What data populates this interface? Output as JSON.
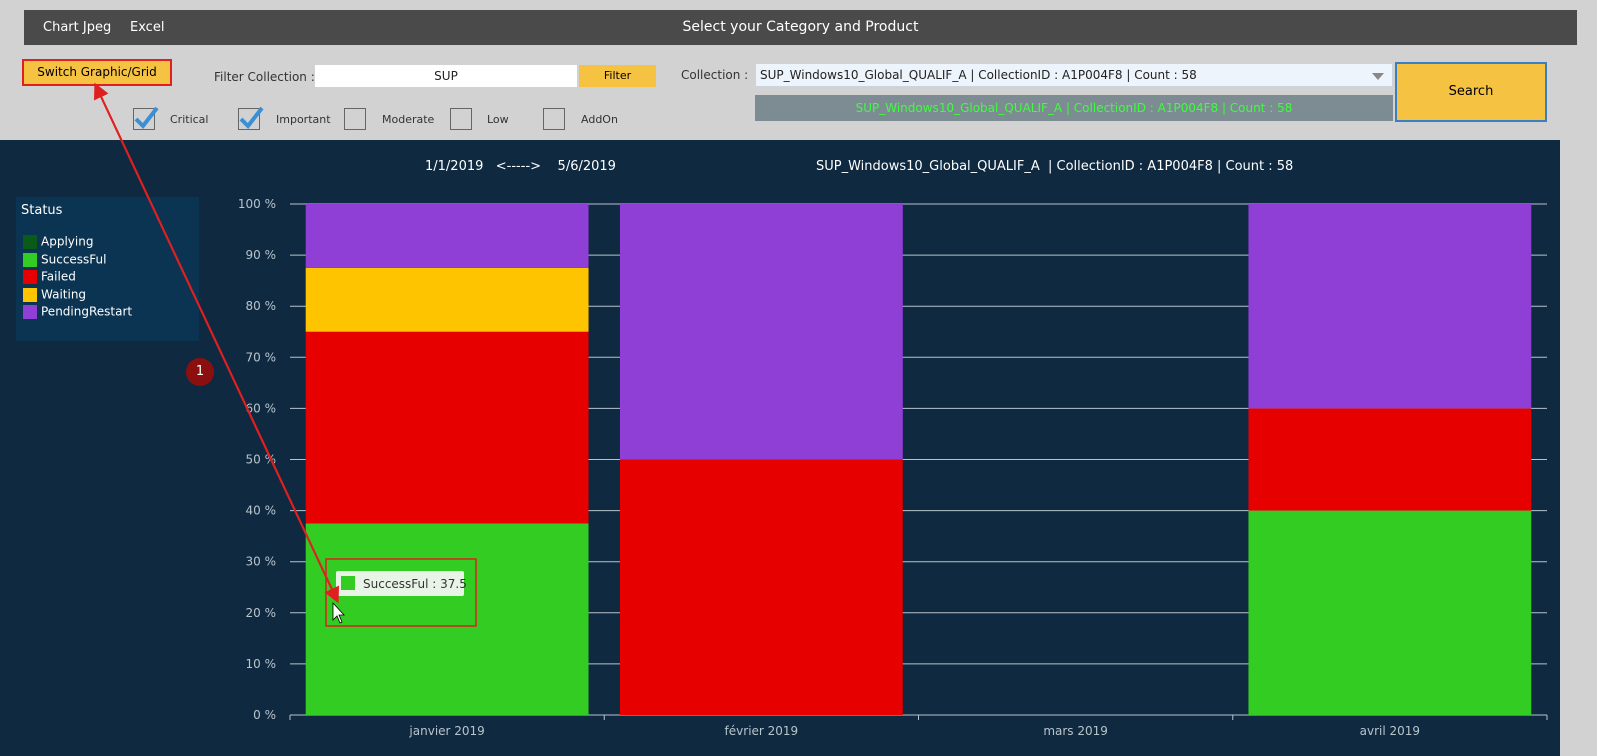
{
  "topbar": {
    "menu": [
      "Chart Jpeg",
      "Excel"
    ],
    "title": "Select your Category and Product"
  },
  "controls": {
    "switch_label": "Switch Graphic/Grid",
    "filter_label": "Filter Collection :",
    "filter_value": "SUP",
    "filter_button": "Filter",
    "collection_label": "Collection :",
    "collection_value": "SUP_Windows10_Global_QUALIF_A  | CollectionID : A1P004F8 | Count : 58",
    "collection_selected_line": "SUP_Windows10_Global_QUALIF_A  | CollectionID : A1P004F8 | Count : 58",
    "search_button": "Search",
    "checkboxes": [
      {
        "label": "Critical",
        "checked": true
      },
      {
        "label": "Important",
        "checked": true
      },
      {
        "label": "Moderate",
        "checked": false
      },
      {
        "label": "Low",
        "checked": false
      },
      {
        "label": "AddOn",
        "checked": false
      }
    ]
  },
  "chart_header": {
    "date_range": "1/1/2019   <----->    5/6/2019",
    "title": "SUP_Windows10_Global_QUALIF_A  | CollectionID : A1P004F8 | Count : 58"
  },
  "legend": {
    "title": "Status",
    "items": [
      {
        "label": "Applying",
        "color": "#0a5a1a"
      },
      {
        "label": "SuccessFul",
        "color": "#33cc22"
      },
      {
        "label": "Failed",
        "color": "#e60000"
      },
      {
        "label": "Waiting",
        "color": "#ffc400"
      },
      {
        "label": "PendingRestart",
        "color": "#8f3fd6"
      }
    ]
  },
  "tooltip": {
    "text": "SuccessFul : 37.5"
  },
  "annotation": {
    "number": "1"
  },
  "chart_data": {
    "type": "bar",
    "stacked": true,
    "categories": [
      "janvier 2019",
      "février 2019",
      "mars 2019",
      "avril 2019"
    ],
    "series": [
      {
        "name": "Applying",
        "color": "#0a5a1a",
        "values": [
          0,
          0,
          0,
          0
        ]
      },
      {
        "name": "SuccessFul",
        "color": "#33cc22",
        "values": [
          37.5,
          0,
          0,
          40
        ]
      },
      {
        "name": "Failed",
        "color": "#e60000",
        "values": [
          37.5,
          50,
          0,
          20
        ]
      },
      {
        "name": "Waiting",
        "color": "#ffc400",
        "values": [
          12.5,
          0,
          0,
          0
        ]
      },
      {
        "name": "PendingRestart",
        "color": "#8f3fd6",
        "values": [
          12.5,
          50,
          0,
          40
        ]
      }
    ],
    "ylim": [
      0,
      100
    ],
    "yticks": [
      "0 %",
      "10 %",
      "20 %",
      "30 %",
      "40 %",
      "50 %",
      "60 %",
      "70 %",
      "80 %",
      "90 %",
      "100 %"
    ],
    "grid": true,
    "legend_position": "left"
  }
}
